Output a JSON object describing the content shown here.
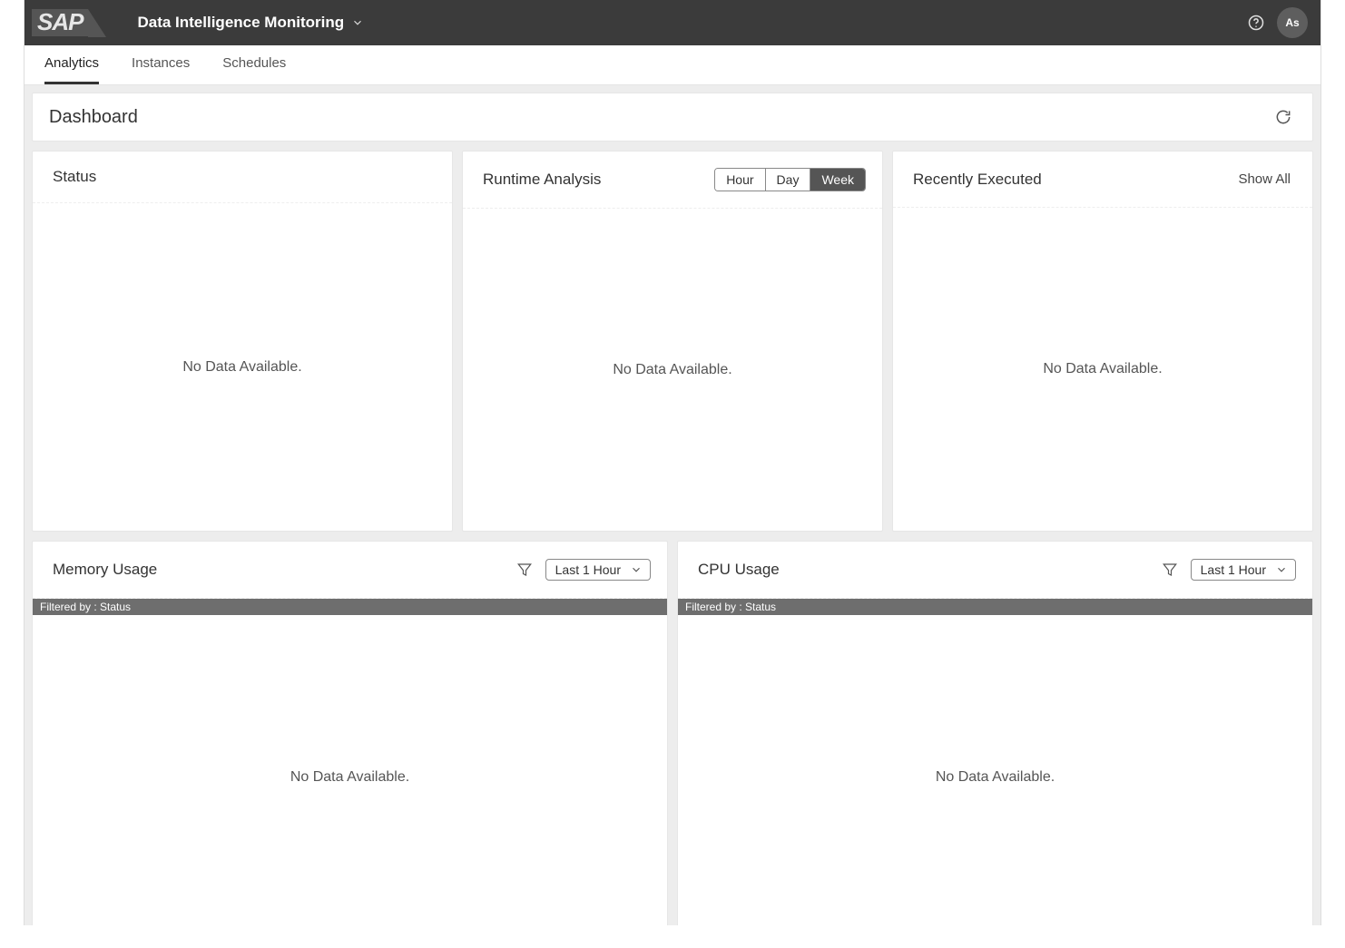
{
  "shell": {
    "logo_text": "SAP",
    "product_title": "Data Intelligence Monitoring",
    "avatar_initials": "As"
  },
  "tabs": {
    "items": [
      {
        "label": "Analytics",
        "active": true
      },
      {
        "label": "Instances",
        "active": false
      },
      {
        "label": "Schedules",
        "active": false
      }
    ]
  },
  "page": {
    "title": "Dashboard"
  },
  "tiles": {
    "status": {
      "title": "Status",
      "empty_text": "No Data Available."
    },
    "runtime": {
      "title": "Runtime Analysis",
      "segments": [
        {
          "label": "Hour",
          "active": false
        },
        {
          "label": "Day",
          "active": false
        },
        {
          "label": "Week",
          "active": true
        }
      ],
      "empty_text": "No Data Available."
    },
    "recent": {
      "title": "Recently Executed",
      "action_label": "Show All",
      "empty_text": "No Data Available."
    },
    "memory": {
      "title": "Memory Usage",
      "range_label": "Last 1 Hour",
      "filter_bar_text": "Filtered by : Status",
      "empty_text": "No Data Available."
    },
    "cpu": {
      "title": "CPU Usage",
      "range_label": "Last 1 Hour",
      "filter_bar_text": "Filtered by : Status",
      "empty_text": "No Data Available."
    }
  }
}
